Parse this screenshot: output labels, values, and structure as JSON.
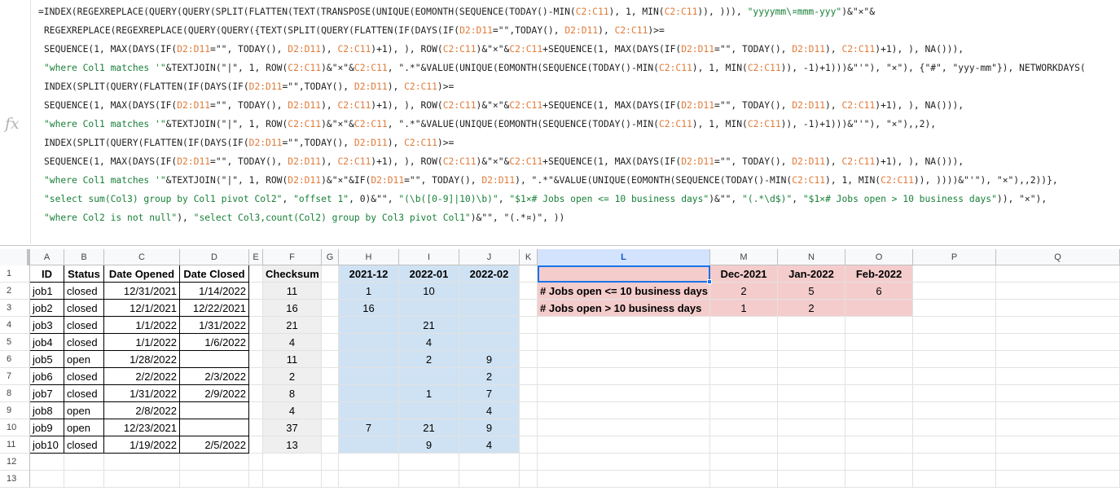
{
  "formula": {
    "lines": [
      [
        [
          "p",
          "=INDEX(REGEXREPLACE(QUERY(QUERY(SPLIT(FLATTEN(TEXT(TRANSPOSE(UNIQUE(EOMONTH(SEQUENCE(TODAY()-MIN("
        ],
        [
          "r",
          "C2:C11"
        ],
        [
          "p",
          "), 1, MIN("
        ],
        [
          "r",
          "C2:C11"
        ],
        [
          "p",
          ")), ))), "
        ],
        [
          "s",
          "\"yyyymm\\¤mmm-yyy\""
        ],
        [
          "p",
          ")&\"×\"&"
        ]
      ],
      [
        [
          "p",
          "REGEXREPLACE(REGEXREPLACE(QUERY(QUERY({TEXT(SPLIT(QUERY(FLATTEN(IF(DAYS(IF("
        ],
        [
          "r",
          "D2:D11"
        ],
        [
          "p",
          "=\"\",TODAY(), "
        ],
        [
          "r",
          "D2:D11"
        ],
        [
          "p",
          "), "
        ],
        [
          "r",
          "C2:C11"
        ],
        [
          "p",
          ")>="
        ]
      ],
      [
        [
          "p",
          "SEQUENCE(1, MAX(DAYS(IF("
        ],
        [
          "r",
          "D2:D11"
        ],
        [
          "p",
          "=\"\", TODAY(), "
        ],
        [
          "r",
          "D2:D11"
        ],
        [
          "p",
          "), "
        ],
        [
          "r",
          "C2:C11"
        ],
        [
          "p",
          ")+1), ), ROW("
        ],
        [
          "r",
          "C2:C11"
        ],
        [
          "p",
          ")&\"×\"&"
        ],
        [
          "r",
          "C2:C11"
        ],
        [
          "p",
          "+SEQUENCE(1, MAX(DAYS(IF("
        ],
        [
          "r",
          "D2:D11"
        ],
        [
          "p",
          "=\"\", TODAY(), "
        ],
        [
          "r",
          "D2:D11"
        ],
        [
          "p",
          "), "
        ],
        [
          "r",
          "C2:C11"
        ],
        [
          "p",
          ")+1), ), NA())),"
        ]
      ],
      [
        [
          "s",
          "\"where Col1 matches '\""
        ],
        [
          "p",
          "&TEXTJOIN(\"|\", 1, ROW("
        ],
        [
          "r",
          "C2:C11"
        ],
        [
          "p",
          ")&\"×\"&"
        ],
        [
          "r",
          "C2:C11"
        ],
        [
          "p",
          ", \".*\"&VALUE(UNIQUE(EOMONTH(SEQUENCE(TODAY()-MIN("
        ],
        [
          "r",
          "C2:C11"
        ],
        [
          "p",
          "), 1, MIN("
        ],
        [
          "r",
          "C2:C11"
        ],
        [
          "p",
          ")), -1)+1)))&\"'\"), \"×\"), {\"#\", \"yyy-mm\"}), NETWORKDAYS("
        ]
      ],
      [
        [
          "p",
          "INDEX(SPLIT(QUERY(FLATTEN(IF(DAYS(IF("
        ],
        [
          "r",
          "D2:D11"
        ],
        [
          "p",
          "=\"\",TODAY(), "
        ],
        [
          "r",
          "D2:D11"
        ],
        [
          "p",
          "), "
        ],
        [
          "r",
          "C2:C11"
        ],
        [
          "p",
          ")>="
        ]
      ],
      [
        [
          "p",
          "SEQUENCE(1, MAX(DAYS(IF("
        ],
        [
          "r",
          "D2:D11"
        ],
        [
          "p",
          "=\"\", TODAY(), "
        ],
        [
          "r",
          "D2:D11"
        ],
        [
          "p",
          "), "
        ],
        [
          "r",
          "C2:C11"
        ],
        [
          "p",
          ")+1), ), ROW("
        ],
        [
          "r",
          "C2:C11"
        ],
        [
          "p",
          ")&\"×\"&"
        ],
        [
          "r",
          "C2:C11"
        ],
        [
          "p",
          "+SEQUENCE(1, MAX(DAYS(IF("
        ],
        [
          "r",
          "D2:D11"
        ],
        [
          "p",
          "=\"\", TODAY(), "
        ],
        [
          "r",
          "D2:D11"
        ],
        [
          "p",
          "), "
        ],
        [
          "r",
          "C2:C11"
        ],
        [
          "p",
          ")+1), ), NA())),"
        ]
      ],
      [
        [
          "s",
          "\"where Col1 matches '\""
        ],
        [
          "p",
          "&TEXTJOIN(\"|\", 1, ROW("
        ],
        [
          "r",
          "C2:C11"
        ],
        [
          "p",
          ")&\"×\"&"
        ],
        [
          "r",
          "C2:C11"
        ],
        [
          "p",
          ", \".*\"&VALUE(UNIQUE(EOMONTH(SEQUENCE(TODAY()-MIN("
        ],
        [
          "r",
          "C2:C11"
        ],
        [
          "p",
          "), 1, MIN("
        ],
        [
          "r",
          "C2:C11"
        ],
        [
          "p",
          ")), -1)+1)))&\"'\"), \"×\"),,2),"
        ]
      ],
      [
        [
          "p",
          "INDEX(SPLIT(QUERY(FLATTEN(IF(DAYS(IF("
        ],
        [
          "r",
          "D2:D11"
        ],
        [
          "p",
          "=\"\",TODAY(), "
        ],
        [
          "r",
          "D2:D11"
        ],
        [
          "p",
          "), "
        ],
        [
          "r",
          "C2:C11"
        ],
        [
          "p",
          ")>="
        ]
      ],
      [
        [
          "p",
          "SEQUENCE(1, MAX(DAYS(IF("
        ],
        [
          "r",
          "D2:D11"
        ],
        [
          "p",
          "=\"\", TODAY(), "
        ],
        [
          "r",
          "D2:D11"
        ],
        [
          "p",
          "), "
        ],
        [
          "r",
          "C2:C11"
        ],
        [
          "p",
          ")+1), ), ROW("
        ],
        [
          "r",
          "C2:C11"
        ],
        [
          "p",
          ")&\"×\"&"
        ],
        [
          "r",
          "C2:C11"
        ],
        [
          "p",
          "+SEQUENCE(1, MAX(DAYS(IF("
        ],
        [
          "r",
          "D2:D11"
        ],
        [
          "p",
          "=\"\", TODAY(), "
        ],
        [
          "r",
          "D2:D11"
        ],
        [
          "p",
          "), "
        ],
        [
          "r",
          "C2:C11"
        ],
        [
          "p",
          ")+1), ), NA())),"
        ]
      ],
      [
        [
          "s",
          "\"where Col1 matches '\""
        ],
        [
          "p",
          "&TEXTJOIN(\"|\", 1, ROW("
        ],
        [
          "r",
          "D2:D11"
        ],
        [
          "p",
          ")&\"×\"&IF("
        ],
        [
          "r",
          "D2:D11"
        ],
        [
          "p",
          "=\"\", TODAY(), "
        ],
        [
          "r",
          "D2:D11"
        ],
        [
          "p",
          "), \".*\"&VALUE(UNIQUE(EOMONTH(SEQUENCE(TODAY()-MIN("
        ],
        [
          "r",
          "C2:C11"
        ],
        [
          "p",
          "), 1, MIN("
        ],
        [
          "r",
          "C2:C11"
        ],
        [
          "p",
          ")), ))))&\"'\"), \"×\"),,2))},"
        ]
      ],
      [
        [
          "s",
          "\"select sum(Col3) group by Col1 pivot Col2\""
        ],
        [
          "p",
          ", "
        ],
        [
          "s",
          "\"offset 1\""
        ],
        [
          "p",
          ", 0)&\"\", "
        ],
        [
          "s",
          "\"(\\b([0-9]|10)\\b)\""
        ],
        [
          "p",
          ", "
        ],
        [
          "s",
          "\"$1×# Jobs open <= 10 business days\""
        ],
        [
          "p",
          ")&\"\", "
        ],
        [
          "s",
          "\"(.*\\d$)\""
        ],
        [
          "p",
          ", "
        ],
        [
          "s",
          "\"$1×# Jobs open > 10 business days\""
        ],
        [
          "p",
          ")), \"×\"),"
        ]
      ],
      [
        [
          "s",
          "\"where Col2 is not null\""
        ],
        [
          "p",
          "), "
        ],
        [
          "s",
          "\"select Col3,count(Col2) group by Col3 pivot Col1\""
        ],
        [
          "p",
          ")&\"\", \"(.*¤)\", ))"
        ]
      ]
    ]
  },
  "columns": [
    "A",
    "B",
    "C",
    "D",
    "E",
    "F",
    "G",
    "H",
    "I",
    "J",
    "K",
    "L",
    "M",
    "N",
    "O",
    "P",
    "Q"
  ],
  "rows": [
    "1",
    "2",
    "3",
    "4",
    "5",
    "6",
    "7",
    "8",
    "9",
    "10",
    "11",
    "12",
    "13"
  ],
  "table": {
    "headers": [
      "ID",
      "Status",
      "Date Opened",
      "Date Closed"
    ],
    "rows": [
      [
        "job1",
        "closed",
        "12/31/2021",
        "1/14/2022"
      ],
      [
        "job2",
        "closed",
        "12/1/2021",
        "12/22/2021"
      ],
      [
        "job3",
        "closed",
        "1/1/2022",
        "1/31/2022"
      ],
      [
        "job4",
        "closed",
        "1/1/2022",
        "1/6/2022"
      ],
      [
        "job5",
        "open",
        "1/28/2022",
        ""
      ],
      [
        "job6",
        "closed",
        "2/2/2022",
        "2/3/2022"
      ],
      [
        "job7",
        "closed",
        "1/31/2022",
        "2/9/2022"
      ],
      [
        "job8",
        "open",
        "2/8/2022",
        ""
      ],
      [
        "job9",
        "open",
        "12/23/2021",
        ""
      ],
      [
        "job10",
        "closed",
        "1/19/2022",
        "2/5/2022"
      ]
    ]
  },
  "checksum": {
    "header": "Checksum",
    "values": [
      "11",
      "16",
      "21",
      "4",
      "11",
      "2",
      "8",
      "4",
      "37",
      "13"
    ]
  },
  "months": {
    "headers": [
      "2021-12",
      "2022-01",
      "2022-02"
    ],
    "rows": [
      [
        "1",
        "10",
        ""
      ],
      [
        "16",
        "",
        ""
      ],
      [
        "",
        "21",
        ""
      ],
      [
        "",
        "4",
        ""
      ],
      [
        "",
        "2",
        "9"
      ],
      [
        "",
        "",
        "2"
      ],
      [
        "",
        "1",
        "7"
      ],
      [
        "",
        "",
        "4"
      ],
      [
        "7",
        "21",
        "9"
      ],
      [
        "",
        "9",
        "4"
      ]
    ]
  },
  "summary": {
    "headers": [
      "",
      "Dec-2021",
      "Jan-2022",
      "Feb-2022"
    ],
    "rows": [
      [
        "# Jobs open <= 10 business days",
        "2",
        "5",
        "6"
      ],
      [
        "# Jobs open > 10 business days",
        "1",
        "2",
        ""
      ]
    ]
  }
}
